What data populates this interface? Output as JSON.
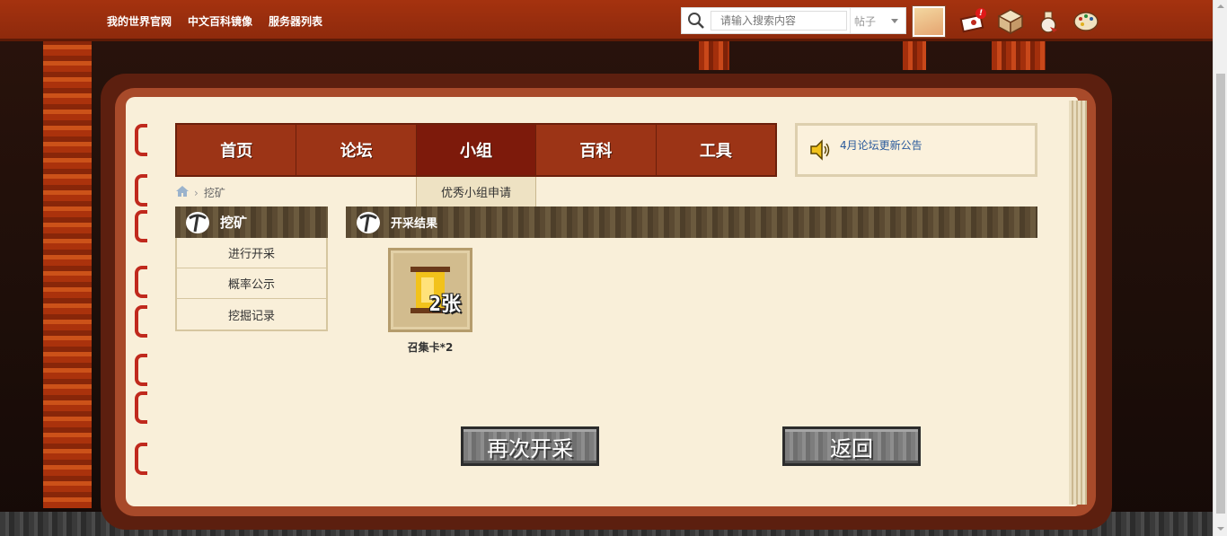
{
  "topbar": {
    "links": [
      "我的世界官网",
      "中文百科镜像",
      "服务器列表"
    ],
    "search_placeholder": "请输入搜索内容",
    "search_type": "帖子",
    "notification_count": "!"
  },
  "nav": {
    "items": [
      "首页",
      "论坛",
      "小组",
      "百科",
      "工具"
    ],
    "active": "小组",
    "sub_item": "优秀小组申请"
  },
  "notice": {
    "text": "4月论坛更新公告"
  },
  "breadcrumb": {
    "current": "挖矿"
  },
  "sidebar": {
    "title": "挖矿",
    "items": [
      "进行开采",
      "概率公示",
      "挖掘记录"
    ]
  },
  "result": {
    "title": "开采结果",
    "item_count_overlay": "2张",
    "item_label": "召集卡*2"
  },
  "buttons": {
    "again": "再次开采",
    "back": "返回"
  },
  "colors": {
    "accent": "#9c3416",
    "link": "#2a5a9c"
  }
}
